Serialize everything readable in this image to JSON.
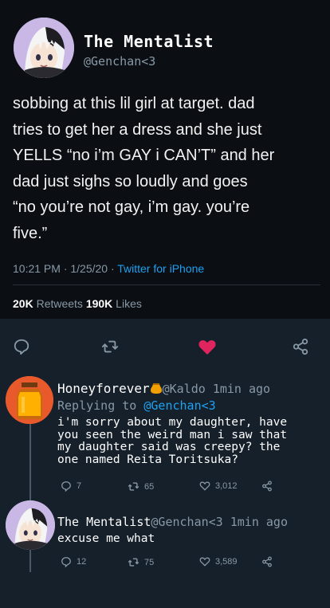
{
  "tweet": {
    "display_name": "The Mentalist",
    "handle": "@Genchan<3",
    "text_lines": [
      "sobbing at this lil girl at target. dad",
      "tries to get her a dress and she just",
      "YELLS “no i’m GAY i CAN’T” and her",
      "dad just sighs so loudly and goes",
      "“no you’re not gay, i’m gay. you’re",
      "five.”"
    ],
    "time": "10:21 PM · 1/25/20 · ",
    "source": "Twitter for iPhone",
    "retweets_count": "20K",
    "retweets_label": " Retweets  ",
    "likes_count": "190K",
    "likes_label": " Likes"
  },
  "actions": {
    "reply_icon": "comment-icon",
    "retweet_icon": "retweet-icon",
    "like_icon": "heart-icon",
    "share_icon": "share-icon",
    "like_color": "#e0245e"
  },
  "replies": [
    {
      "name": "Honeyforever",
      "badge_icon": "honey-pot-icon",
      "handle": "@Kaldo",
      "time": "1min ago",
      "replying_prefix": "Replying to ",
      "replying_to": "@Genchan<3",
      "body_lines": [
        "i'm sorry about my daughter, have",
        "you seen the weird man i saw that",
        "my daughter said was creepy? the",
        "one named Reita Toritsuka?"
      ],
      "replies": "7",
      "retweets": "65",
      "likes": "3,012"
    },
    {
      "name": "The Mentalist",
      "handle": "@Genchan<3",
      "time": "1min ago",
      "body_lines": [
        "excuse me what"
      ],
      "replies": "12",
      "retweets": "75",
      "likes": "3,589"
    }
  ],
  "colors": {
    "background": "#15202b",
    "card": "#0b0e12",
    "link": "#1da1f2",
    "muted": "#8899a6"
  }
}
